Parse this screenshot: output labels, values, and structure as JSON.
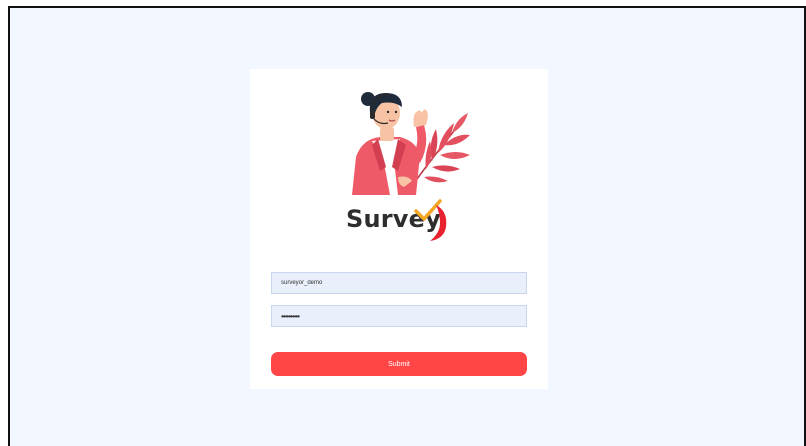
{
  "brand": {
    "logo_text": "Survey",
    "accent_color": "#ff4545",
    "logo_mark_icon": "red-swoosh-check-icon"
  },
  "illustration": {
    "icon": "support-agent-with-headset-and-leaves-icon"
  },
  "login_form": {
    "username_value": "surveyor_demo",
    "password_value": "••••••••••",
    "submit_label": "Submit"
  }
}
